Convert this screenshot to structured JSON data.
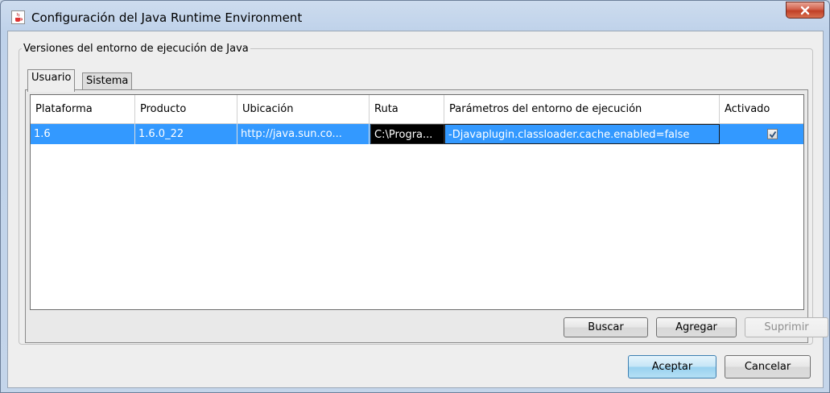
{
  "window": {
    "title": "Configuración del Java Runtime Environment"
  },
  "group": {
    "legend": "Versiones del entorno de ejecución de Java"
  },
  "tabs": [
    {
      "label": "Usuario",
      "active": true
    },
    {
      "label": "Sistema",
      "active": false
    }
  ],
  "table": {
    "columns": [
      "Plataforma",
      "Producto",
      "Ubicación",
      "Ruta",
      "Parámetros del entorno de ejecución",
      "Activado"
    ],
    "rows": [
      {
        "platform": "1.6",
        "product": "1.6.0_22",
        "location": "http://java.sun.co...",
        "path": "C:\\Progra...",
        "params": "-Djavaplugin.classloader.cache.enabled=false",
        "enabled": true
      }
    ]
  },
  "buttons": {
    "buscar": "Buscar",
    "agregar": "Agregar",
    "suprimir": "Suprimir",
    "aceptar": "Aceptar",
    "cancelar": "Cancelar"
  },
  "colors": {
    "selection": "#3399ff",
    "close_button": "#c9452d"
  }
}
